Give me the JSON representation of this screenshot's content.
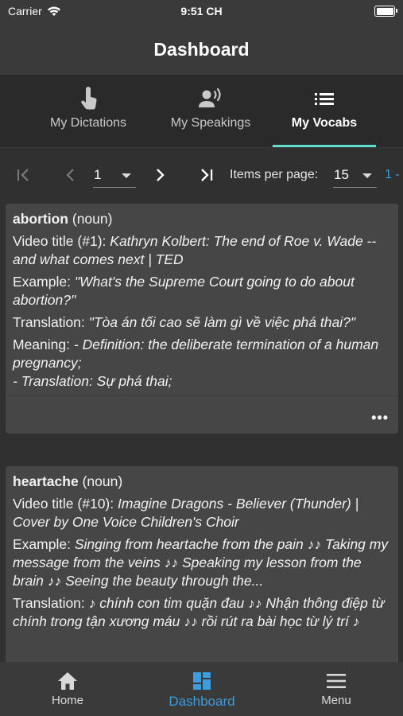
{
  "status_bar": {
    "carrier": "Carrier",
    "time": "9:51 CH"
  },
  "app_bar": {
    "title": "Dashboard"
  },
  "tabs": [
    {
      "label": "My Dictations",
      "icon": "touch-icon",
      "active": false
    },
    {
      "label": "My Speakings",
      "icon": "voice-icon",
      "active": false
    },
    {
      "label": "My Vocabs",
      "icon": "list-icon",
      "active": true
    }
  ],
  "pagination": {
    "page": "1",
    "items_per_page_label": "Items per page:",
    "items_per_page": "15",
    "range": "1 -"
  },
  "vocab_cards": [
    {
      "word": "abortion",
      "pos": "(noun)",
      "video_label": "Video title (#1):",
      "video_title": "Kathryn Kolbert: The end of Roe v. Wade -- and what comes next | TED",
      "example_label": "Example:",
      "example": "\"What's the Supreme Court going to do about abortion?\"",
      "translation_label": "Translation:",
      "translation": "\"Tòa án tối cao sẽ làm gì về việc phá thai?\"",
      "meaning_label": "Meaning:",
      "meaning_line1": "- Definition: the deliberate termination of a human pregnancy;",
      "meaning_line2": "- Translation: Sự phá thai;"
    },
    {
      "word": "heartache",
      "pos": "(noun)",
      "video_label": "Video title (#10):",
      "video_title": "Imagine Dragons - Believer (Thunder) | Cover by One Voice Children's Choir",
      "example_label": "Example:",
      "example": "Singing from heartache from the pain ♪♪ Taking my message from the veins ♪♪ Speaking my lesson from the brain ♪♪ Seeing the beauty through the...",
      "translation_label": "Translation:",
      "translation": "♪ chính con tim quặn đau ♪♪ Nhận thông điệp từ chính trong tận xương máu ♪♪ rồi rút ra bài học từ lý trí ♪"
    }
  ],
  "bottom_nav": [
    {
      "label": "Home",
      "icon": "home-icon",
      "active": false
    },
    {
      "label": "Dashboard",
      "icon": "dashboard-icon",
      "active": true
    },
    {
      "label": "Menu",
      "icon": "menu-icon",
      "active": false
    }
  ],
  "colors": {
    "accent": "#3b9ddd",
    "tab_indicator": "#5fe1c9",
    "card": "#464646",
    "background": "#303030"
  }
}
